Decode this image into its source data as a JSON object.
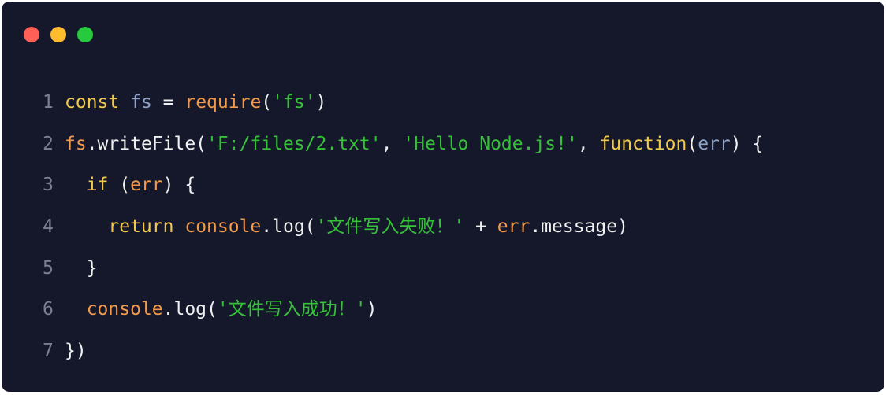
{
  "window": {
    "traffic_lights": [
      {
        "name": "close",
        "color": "#ff5f56"
      },
      {
        "name": "minimize",
        "color": "#ffbd2e"
      },
      {
        "name": "maximize",
        "color": "#27c93f"
      }
    ]
  },
  "code": {
    "lines": [
      {
        "number": "1",
        "tokens": [
          {
            "t": "const",
            "c": "kw"
          },
          {
            "t": " ",
            "c": "plain"
          },
          {
            "t": "fs",
            "c": "var"
          },
          {
            "t": " = ",
            "c": "plain"
          },
          {
            "t": "require",
            "c": "fn"
          },
          {
            "t": "(",
            "c": "plain"
          },
          {
            "t": "'fs'",
            "c": "str"
          },
          {
            "t": ")",
            "c": "plain"
          }
        ]
      },
      {
        "number": "2",
        "tokens": [
          {
            "t": "fs",
            "c": "fn"
          },
          {
            "t": ".writeFile(",
            "c": "plain"
          },
          {
            "t": "'F:/files/2.txt'",
            "c": "str"
          },
          {
            "t": ", ",
            "c": "plain"
          },
          {
            "t": "'Hello Node.js!'",
            "c": "str"
          },
          {
            "t": ", ",
            "c": "plain"
          },
          {
            "t": "function",
            "c": "kw"
          },
          {
            "t": "(",
            "c": "plain"
          },
          {
            "t": "err",
            "c": "var"
          },
          {
            "t": ") {",
            "c": "plain"
          }
        ]
      },
      {
        "number": "3",
        "tokens": [
          {
            "t": "  ",
            "c": "plain"
          },
          {
            "t": "if",
            "c": "kw"
          },
          {
            "t": " (",
            "c": "plain"
          },
          {
            "t": "err",
            "c": "fn"
          },
          {
            "t": ") {",
            "c": "plain"
          }
        ]
      },
      {
        "number": "4",
        "tokens": [
          {
            "t": "    ",
            "c": "plain"
          },
          {
            "t": "return",
            "c": "kw"
          },
          {
            "t": " ",
            "c": "plain"
          },
          {
            "t": "console",
            "c": "fn"
          },
          {
            "t": ".log(",
            "c": "plain"
          },
          {
            "t": "'文件写入失败！'",
            "c": "str"
          },
          {
            "t": " + ",
            "c": "plain"
          },
          {
            "t": "err",
            "c": "fn"
          },
          {
            "t": ".message)",
            "c": "plain"
          }
        ]
      },
      {
        "number": "5",
        "tokens": [
          {
            "t": "  }",
            "c": "plain"
          }
        ]
      },
      {
        "number": "6",
        "tokens": [
          {
            "t": "  ",
            "c": "plain"
          },
          {
            "t": "console",
            "c": "fn"
          },
          {
            "t": ".log(",
            "c": "plain"
          },
          {
            "t": "'文件写入成功！'",
            "c": "str"
          },
          {
            "t": ")",
            "c": "plain"
          }
        ]
      },
      {
        "number": "7",
        "tokens": [
          {
            "t": "})",
            "c": "plain"
          }
        ]
      }
    ]
  }
}
